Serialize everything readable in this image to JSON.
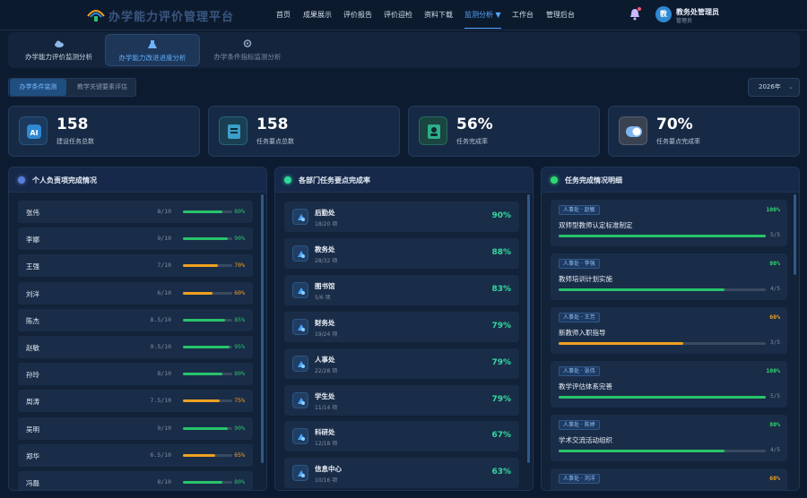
{
  "header": {
    "title": "办学能力评价管理平台",
    "nav": [
      {
        "label": "首页",
        "active": false
      },
      {
        "label": "成果展示",
        "active": false
      },
      {
        "label": "评价报告",
        "active": false
      },
      {
        "label": "评价迎检",
        "active": false
      },
      {
        "label": "资料下载",
        "active": false
      },
      {
        "label": "监测分析 ▼",
        "active": true
      },
      {
        "label": "工作台",
        "active": false
      },
      {
        "label": "管理后台",
        "active": false
      }
    ],
    "user": {
      "avatar": "教",
      "name": "教务处管理员",
      "role": "管理员"
    },
    "notification_icon": "bell-icon"
  },
  "tabs": [
    {
      "label": "办学能力评价监测分析",
      "active": false,
      "icon": "cloud-icon"
    },
    {
      "label": "办学能力改进进度分析",
      "active": true,
      "icon": "flask-icon"
    },
    {
      "label": "办学条件指标监测分析",
      "active": false,
      "icon": "gear-icon"
    }
  ],
  "filter": {
    "segments": [
      {
        "label": "办学条件监测",
        "active": true
      },
      {
        "label": "教学关键要素评估",
        "active": false
      }
    ],
    "year": "2026年"
  },
  "stats": [
    {
      "value": "158",
      "label": "建设任务总数",
      "icon": "ai-chip-icon"
    },
    {
      "value": "158",
      "label": "任务要点总数",
      "icon": "document-icon"
    },
    {
      "value": "56%",
      "label": "任务完成率",
      "icon": "user-badge-icon"
    },
    {
      "value": "70%",
      "label": "任务要点完成率",
      "icon": "toggle-icon"
    }
  ],
  "panels": {
    "personal": {
      "title": "个人负责项完成情况",
      "rows": [
        {
          "name": "张伟",
          "ratio": "8/10",
          "pct": "80%",
          "progress": 0.8,
          "color": "#27c46b"
        },
        {
          "name": "李娜",
          "ratio": "9/10",
          "pct": "90%",
          "progress": 0.9,
          "color": "#27c46b"
        },
        {
          "name": "王强",
          "ratio": "7/10",
          "pct": "70%",
          "progress": 0.7,
          "color": "#f0a020"
        },
        {
          "name": "刘洋",
          "ratio": "6/10",
          "pct": "60%",
          "progress": 0.6,
          "color": "#f0a020"
        },
        {
          "name": "陈杰",
          "ratio": "8.5/10",
          "pct": "85%",
          "progress": 0.85,
          "color": "#27c46b"
        },
        {
          "name": "赵敏",
          "ratio": "9.5/10",
          "pct": "95%",
          "progress": 0.95,
          "color": "#27c46b"
        },
        {
          "name": "孙玲",
          "ratio": "8/10",
          "pct": "80%",
          "progress": 0.8,
          "color": "#27c46b"
        },
        {
          "name": "周涛",
          "ratio": "7.5/10",
          "pct": "75%",
          "progress": 0.75,
          "color": "#f0a020"
        },
        {
          "name": "吴明",
          "ratio": "9/10",
          "pct": "90%",
          "progress": 0.9,
          "color": "#27c46b"
        },
        {
          "name": "郑华",
          "ratio": "6.5/10",
          "pct": "65%",
          "progress": 0.65,
          "color": "#f0a020"
        },
        {
          "name": "冯磊",
          "ratio": "8/10",
          "pct": "80%",
          "progress": 0.8,
          "color": "#27c46b"
        }
      ]
    },
    "departments": {
      "title": "各部门任务要点完成率",
      "rows": [
        {
          "name": "后勤处",
          "count": "18/20 项",
          "pct": "90%"
        },
        {
          "name": "教务处",
          "count": "28/32 项",
          "pct": "88%"
        },
        {
          "name": "图书馆",
          "count": "5/6 项",
          "pct": "83%"
        },
        {
          "name": "财务处",
          "count": "19/24 项",
          "pct": "79%"
        },
        {
          "name": "人事处",
          "count": "22/28 项",
          "pct": "79%"
        },
        {
          "name": "学生处",
          "count": "11/14 项",
          "pct": "79%"
        },
        {
          "name": "科研处",
          "count": "12/18 项",
          "pct": "67%"
        },
        {
          "name": "信息中心",
          "count": "10/16 项",
          "pct": "63%"
        }
      ]
    },
    "tasks": {
      "title": "任务完成情况明细",
      "rows": [
        {
          "tag": "人事处 · 赵敏",
          "name": "双师型教师认定标准制定",
          "pct": "100%",
          "ratio": "5/5",
          "progress": 1.0,
          "color": "#27c46b"
        },
        {
          "tag": "人事处 · 李强",
          "name": "教师培训计划实施",
          "pct": "80%",
          "ratio": "4/5",
          "progress": 0.8,
          "color": "#27c46b"
        },
        {
          "tag": "人事处 · 王芳",
          "name": "新教师入职指导",
          "pct": "60%",
          "ratio": "3/5",
          "progress": 0.6,
          "color": "#f0a020"
        },
        {
          "tag": "人事处 · 张伟",
          "name": "教学评估体系完善",
          "pct": "100%",
          "ratio": "5/5",
          "progress": 1.0,
          "color": "#27c46b"
        },
        {
          "tag": "人事处 · 陈婷",
          "name": "学术交流活动组织",
          "pct": "80%",
          "ratio": "4/5",
          "progress": 0.8,
          "color": "#27c46b"
        },
        {
          "tag": "人事处 · 刘洋",
          "name": "",
          "pct": "60%",
          "ratio": "",
          "progress": 0.6,
          "color": "#f0a020"
        }
      ]
    }
  }
}
